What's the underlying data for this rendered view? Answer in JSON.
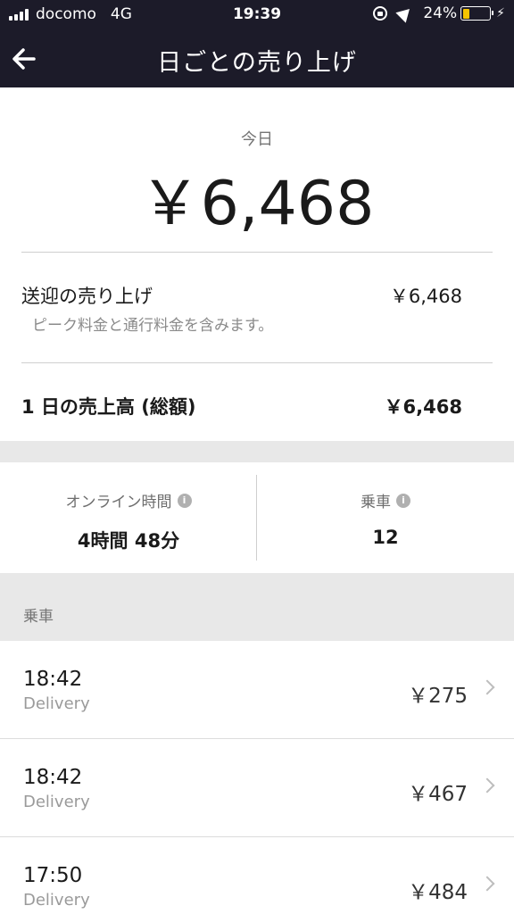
{
  "status_bar": {
    "carrier": "docomo",
    "network": "4G",
    "time": "19:39",
    "battery_percent": "24%",
    "battery_level": 0.24,
    "battery_color": "#f5c400"
  },
  "nav": {
    "back_icon": "arrow-left-icon",
    "title": "日ごとの売り上げ"
  },
  "summary": {
    "today_label": "今日",
    "today_amount": "￥6,468"
  },
  "breakdown": {
    "pickup_label": "送迎の売り上げ",
    "pickup_value": "￥6,468",
    "pickup_note": "ピーク料金と通行料金を含みます。",
    "total_label": "1 日の売上高 (総額)",
    "total_value": "￥6,468"
  },
  "stats": {
    "online_label": "オンライン時間",
    "online_value": "4時間 48分",
    "rides_label": "乗車",
    "rides_value": "12",
    "info_icon": "i"
  },
  "trips_section": {
    "header": "乗車",
    "items": [
      {
        "time": "18:42",
        "type": "Delivery",
        "fare": "￥275"
      },
      {
        "time": "18:42",
        "type": "Delivery",
        "fare": "￥467"
      },
      {
        "time": "17:50",
        "type": "Delivery",
        "fare": "￥484"
      }
    ]
  },
  "colors": {
    "header_bg": "#1c1b29",
    "band_bg": "#e8e8e8"
  }
}
